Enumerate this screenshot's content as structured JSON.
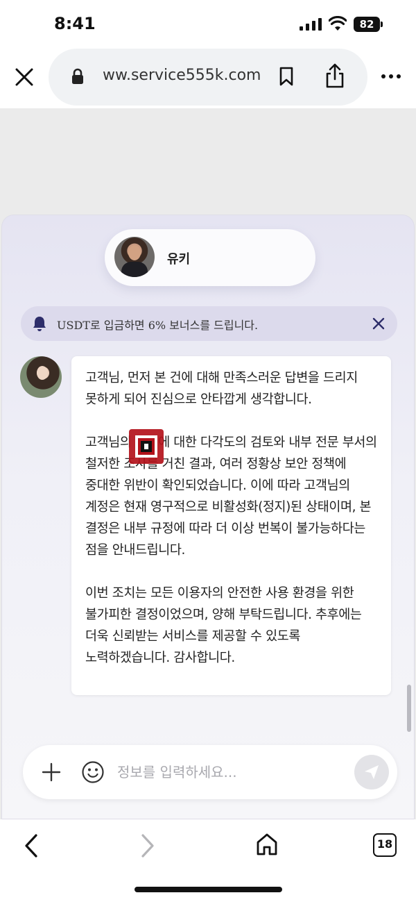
{
  "status_bar": {
    "time": "8:41",
    "battery": "82"
  },
  "browser": {
    "url": "ww.service555k.com",
    "icons": [
      "close-icon",
      "lock-icon",
      "bookmark-icon",
      "share-icon",
      "more-icon"
    ]
  },
  "chat": {
    "agent_name": "유키",
    "notice": "USDT로 입금하면 6% 보너스를 드립니다.",
    "message_paragraphs": [
      "고객님, 먼저 본 건에 대해 만족스러운 답변을 드리지 못하게 되어 진심으로 안타깝게 생각합니다.",
      "고객님의 계정에 대한 다각도의 검토와 내부 전문 부서의 철저한 조사를 거친 결과, 여러 정황상 보안 정책에 중대한 위반이 확인되었습니다. 이에 따라 고객님의 계정은 현재 영구적으로 비활성화(정지)된 상태이며, 본 결정은 내부 규정에 따라 더 이상 번복이 불가능하다는 점을 안내드립니다.",
      "이번 조치는 모든 이용자의 안전한 사용 환경을 위한 불가피한 결정이었으며, 양해 부탁드립니다. 추후에는 더욱 신뢰받는 서비스를 제공할 수 있도록 노력하겠습니다. 감사합니다."
    ],
    "input_placeholder": "정보를 입력하세요..."
  },
  "toolbar": {
    "tab_count": "18"
  },
  "colors": {
    "panel_top": "#e5e4f2",
    "notice_bg": "#dcdaec",
    "watermark": "#b3121b"
  }
}
